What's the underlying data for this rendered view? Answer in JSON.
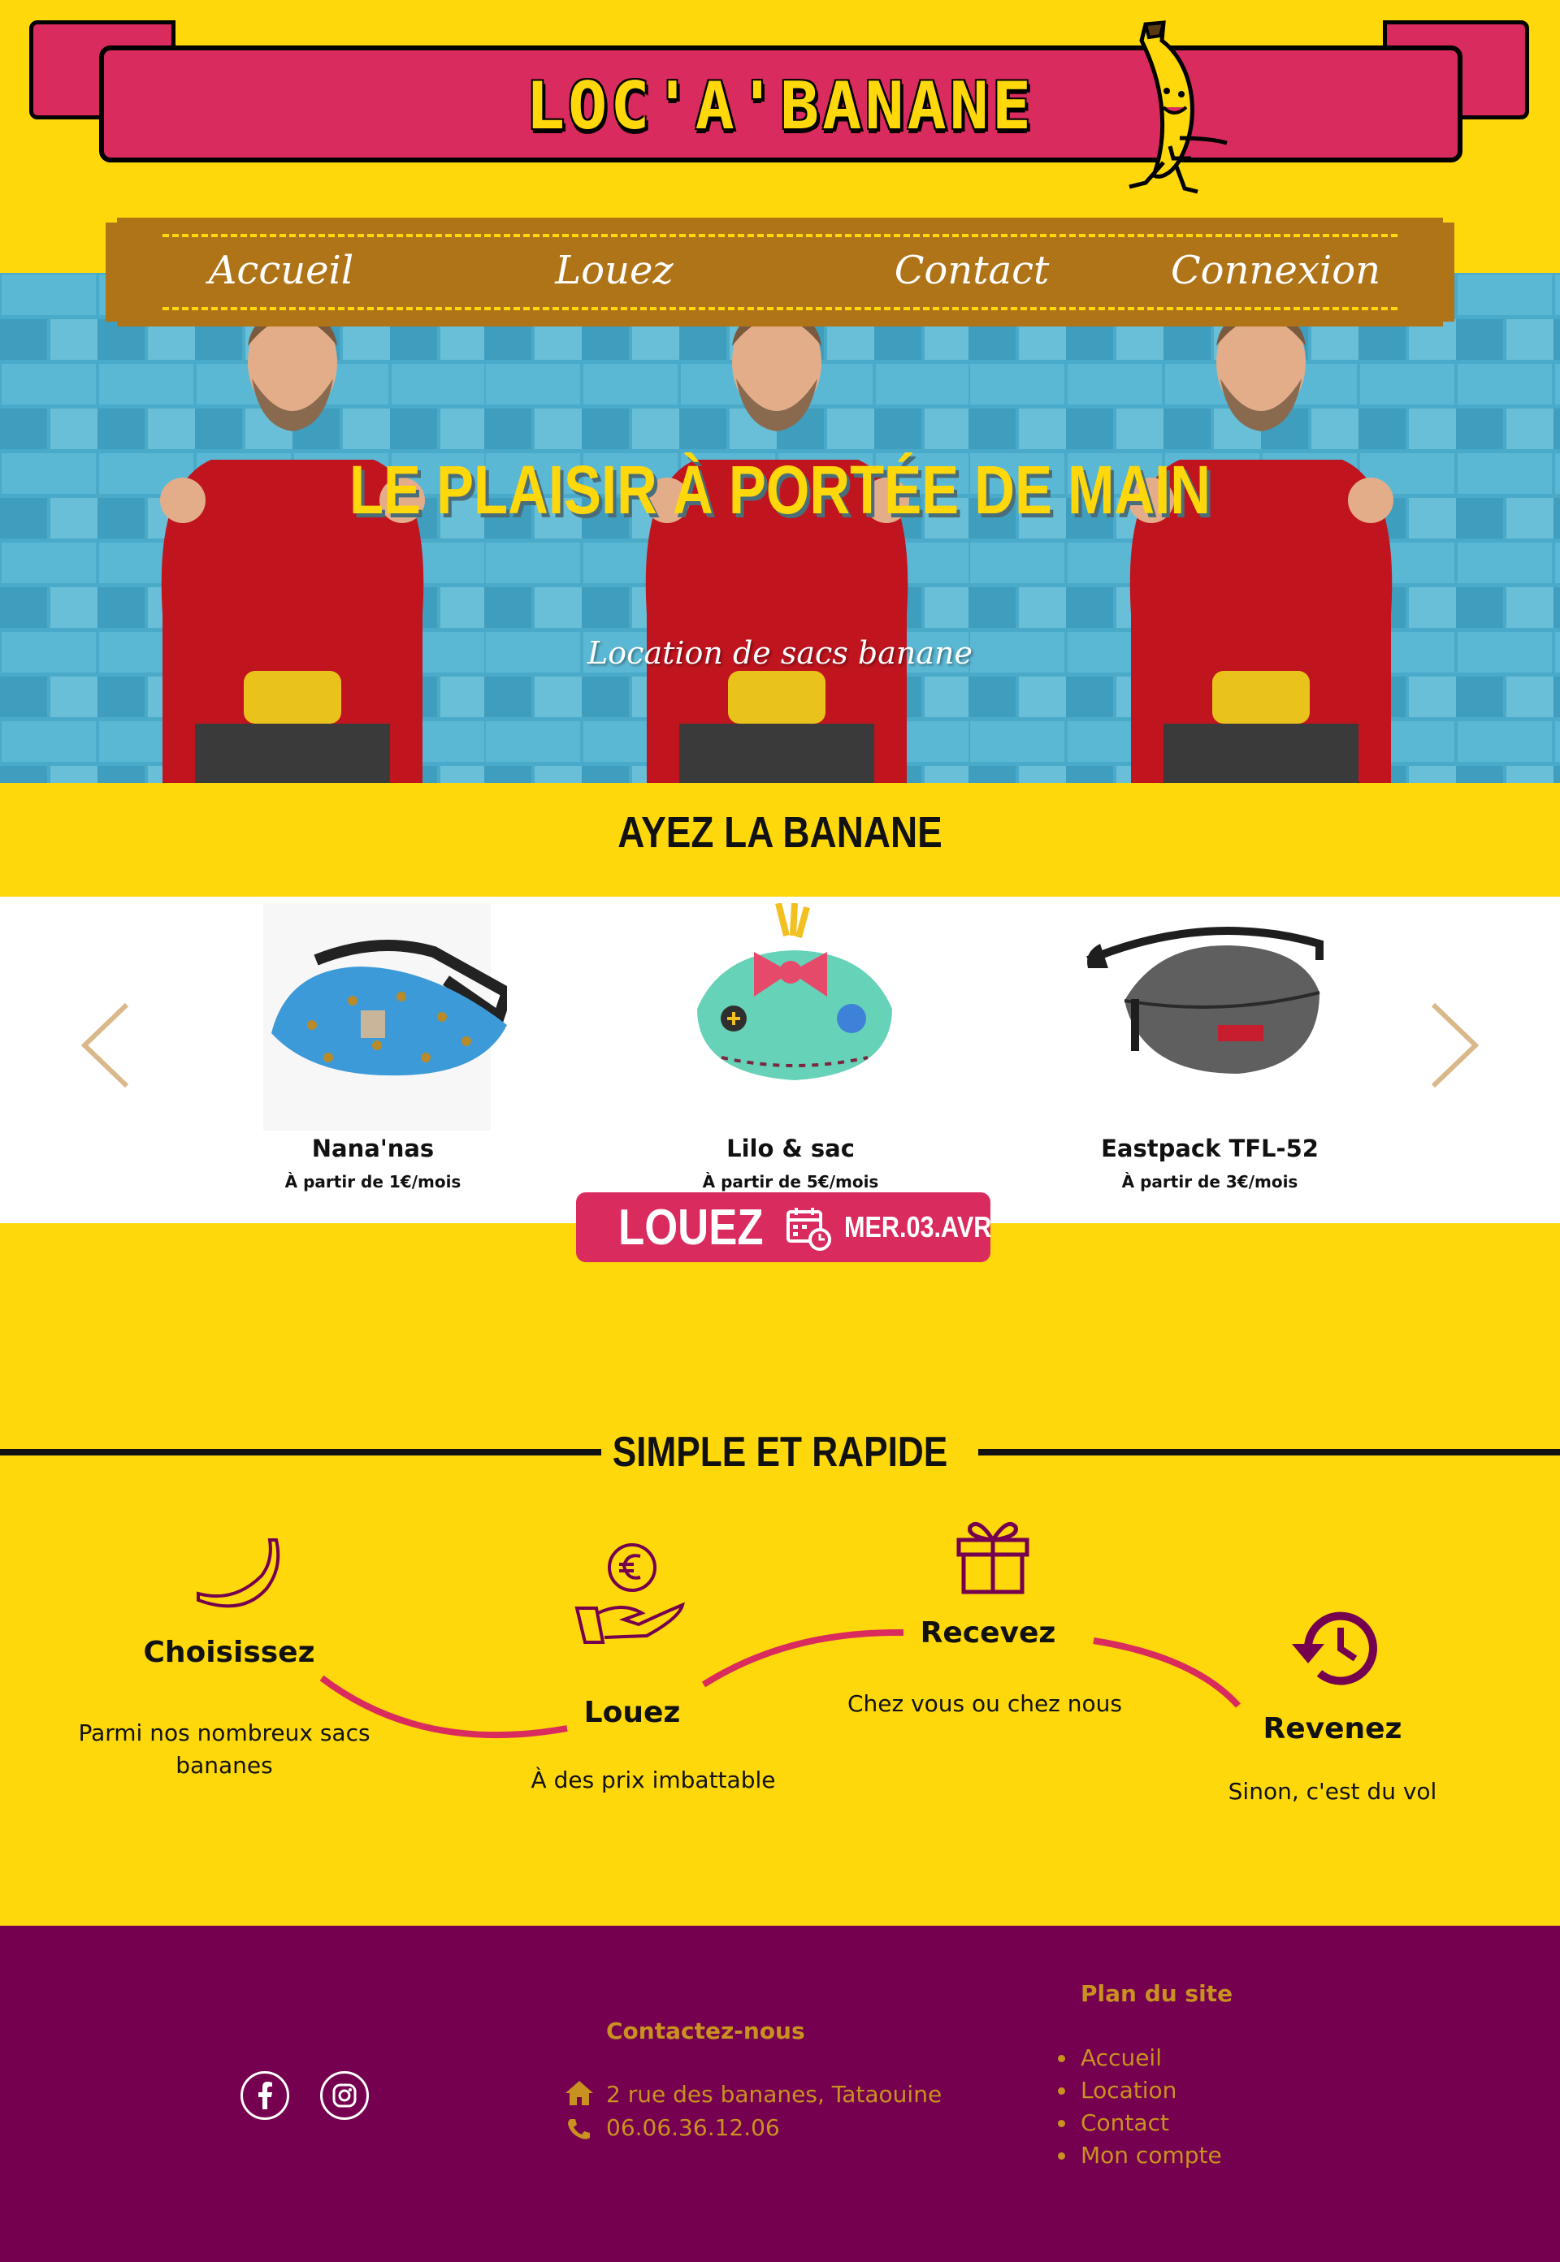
{
  "header": {
    "title": "LOC'A'BANANE"
  },
  "nav": {
    "items": [
      "Accueil",
      "Louez",
      "Contact",
      "Connexion"
    ]
  },
  "hero": {
    "headline": "LE PLAISIR À PORTÉE DE MAIN",
    "tagline": "Location de sacs banane"
  },
  "featured": {
    "title": "AYEZ LA BANANE",
    "products": [
      {
        "name": "Nana'nas",
        "price": "À partir de 1€/mois"
      },
      {
        "name": "Lilo & sac",
        "price": "À partir de 5€/mois"
      },
      {
        "name": "Eastpack TFL-52",
        "price": "À partir de 3€/mois"
      }
    ],
    "rent_button": "LOUEZ",
    "rent_date": "MER.03.AVR"
  },
  "steps": {
    "title": "SIMPLE ET RAPIDE",
    "items": [
      {
        "title": "Choisissez",
        "desc": "Parmi nos nombreux sacs bananes",
        "icon": "banana-icon"
      },
      {
        "title": "Louez",
        "desc": "À des prix imbattable",
        "icon": "euro-hand-icon"
      },
      {
        "title": "Recevez",
        "desc": "Chez vous ou chez nous",
        "icon": "gift-icon"
      },
      {
        "title": "Revenez",
        "desc": "Sinon, c'est du vol",
        "icon": "history-icon"
      }
    ]
  },
  "footer": {
    "contact_heading": "Contactez-nous",
    "address": "2 rue des bananes, Tataouine",
    "phone": "06.06.36.12.06",
    "sitemap_heading": "Plan du site",
    "sitemap": [
      "Accueil",
      "Location",
      "Contact",
      "Mon compte"
    ],
    "social": [
      "facebook-icon",
      "instagram-icon"
    ]
  },
  "colors": {
    "yellow": "#fed80b",
    "pink": "#d92b5e",
    "brown": "#b07418",
    "purple": "#74004f",
    "gold": "#c9911f"
  }
}
